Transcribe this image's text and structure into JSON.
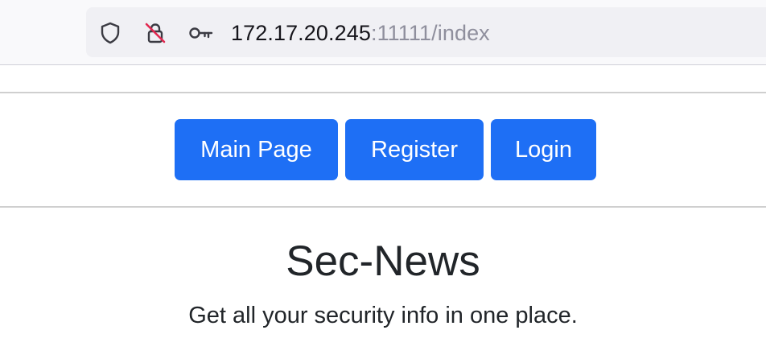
{
  "browser": {
    "url_host": "172.17.20.245",
    "url_rest": ":11111/index",
    "icons": {
      "shield": "shield-icon",
      "lock": "insecure-lock-icon",
      "key": "key-icon"
    }
  },
  "nav": {
    "buttons": [
      {
        "label": "Main Page"
      },
      {
        "label": "Register"
      },
      {
        "label": "Login"
      }
    ],
    "button_color": "#1e6ff5"
  },
  "hero": {
    "title": "Sec-News",
    "subtitle": "Get all your security info in one place."
  }
}
